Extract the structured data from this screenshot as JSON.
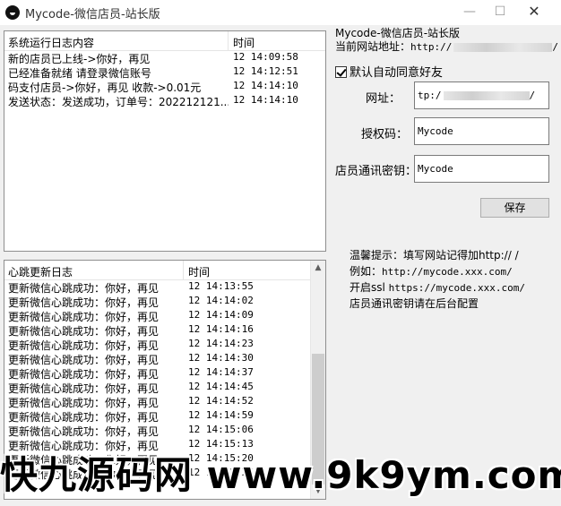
{
  "window": {
    "title": "Mycode-微信店员-站长版"
  },
  "log_panel": {
    "columns": [
      "系统运行日志内容",
      "时间"
    ],
    "rows": [
      {
        "content": "新的店员已上线->你好，再见",
        "time": "12 14:09:58"
      },
      {
        "content": "已经准备就绪 请登录微信账号",
        "time": "12 14:12:51"
      },
      {
        "content": "码支付店员->你好，再见 收款->0.01元",
        "time": "12 14:14:10"
      },
      {
        "content": "发送状态：发送成功，订单号：202212121...",
        "time": "12 14:14:10"
      }
    ]
  },
  "heartbeat_panel": {
    "columns": [
      "心跳更新日志",
      "时间"
    ],
    "rows": [
      {
        "content": "更新微信心跳成功：你好，再见",
        "time": "12 14:13:55"
      },
      {
        "content": "更新微信心跳成功：你好，再见",
        "time": "12 14:14:02"
      },
      {
        "content": "更新微信心跳成功：你好，再见",
        "time": "12 14:14:09"
      },
      {
        "content": "更新微信心跳成功：你好，再见",
        "time": "12 14:14:16"
      },
      {
        "content": "更新微信心跳成功：你好，再见",
        "time": "12 14:14:23"
      },
      {
        "content": "更新微信心跳成功：你好，再见",
        "time": "12 14:14:30"
      },
      {
        "content": "更新微信心跳成功：你好，再见",
        "time": "12 14:14:37"
      },
      {
        "content": "更新微信心跳成功：你好，再见",
        "time": "12 14:14:45"
      },
      {
        "content": "更新微信心跳成功：你好，再见",
        "time": "12 14:14:52"
      },
      {
        "content": "更新微信心跳成功：你好，再见",
        "time": "12 14:14:59"
      },
      {
        "content": "更新微信心跳成功：你好，再见",
        "time": "12 14:15:06"
      },
      {
        "content": "更新微信心跳成功：你好，再见",
        "time": "12 14:15:13"
      },
      {
        "content": "更新微信心跳成功：你好，再见",
        "time": "12 14:15:20"
      },
      {
        "content": "更新微信心跳成功：你好，再见",
        "time": "12 14:15:27"
      }
    ]
  },
  "settings": {
    "heading": "Mycode-微信店员-站长版",
    "site_url_label": "当前网站地址：",
    "site_url_value": "http://",
    "auto_accept_label": "默认自动同意好友",
    "auto_accept_checked": true,
    "url_label": "网址：",
    "url_value": "tp:/",
    "url_suffix": "/",
    "auth_label": "授权码：",
    "auth_value": "Mycode",
    "key_label": "店员通讯密钥：",
    "key_value": "Mycode",
    "save_label": "保存"
  },
  "tips": {
    "line1": "温馨提示：填写网站记得加http:// /",
    "line2_label": "例如：",
    "line2_value": "http://mycode.xxx.com/",
    "line3_label": "开启ssl",
    "line3_value": "https://mycode.xxx.com/",
    "line4": "店员通讯密钥请在后台配置"
  },
  "watermark": {
    "text": "快九源码网 www.9k9ym.com"
  },
  "icons": {
    "app": "app-logo-icon",
    "minimize": "minimize-icon",
    "maximize": "maximize-icon",
    "close": "close-icon",
    "scroll_up": "scroll-up-icon",
    "scroll_down": "scroll-down-icon"
  }
}
